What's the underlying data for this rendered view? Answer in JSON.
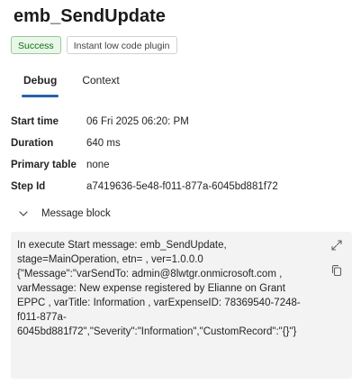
{
  "header": {
    "title": "emb_SendUpdate"
  },
  "badges": {
    "status": "Success",
    "plugin": "Instant low code plugin"
  },
  "tabs": [
    {
      "label": "Debug",
      "active": true
    },
    {
      "label": "Context",
      "active": false
    }
  ],
  "details": {
    "start_time_label": "Start time",
    "start_time_value": "06 Fri 2025 06:20: PM",
    "duration_label": "Duration",
    "duration_value": "640 ms",
    "primary_table_label": "Primary table",
    "primary_table_value": "none",
    "step_id_label": "Step Id",
    "step_id_value": "a7419636-5e48-f011-877a-6045bd881f72"
  },
  "message": {
    "header": "Message block",
    "text": "In execute Start message: emb_SendUpdate,\nstage=MainOperation, etn= , ver=1.0.0.0\n{\"Message\":\"varSendTo: admin@8lwtgr.onmicrosoft.com ,\nvarMessage: New expense registered by Elianne on Grant\nEPPC , varTitle: Information , varExpenseID: 78369540-7248-\nf011-877a-\n6045bd881f72\",\"Severity\":\"Information\",\"CustomRecord\":\"{}\"}"
  },
  "icons": {
    "chevron": "chevron-down-icon",
    "expand": "expand-icon",
    "copy": "copy-icon"
  }
}
